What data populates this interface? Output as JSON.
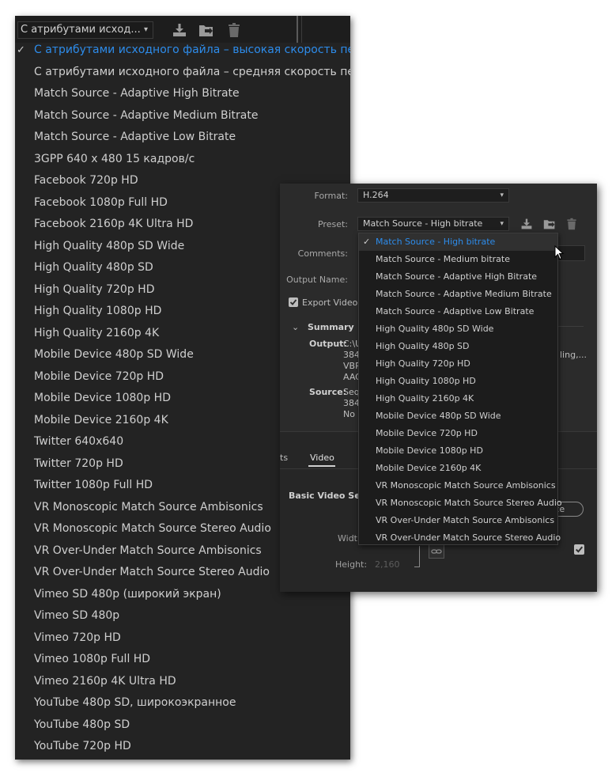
{
  "left": {
    "select_value": "С атрибутами исход...",
    "items": [
      {
        "label": "С атрибутами исходного файла – высокая скорость передачи",
        "selected": true
      },
      {
        "label": "С атрибутами исходного файла – средняя скорость передачи"
      },
      {
        "label": "Match Source - Adaptive High Bitrate"
      },
      {
        "label": "Match Source - Adaptive Medium Bitrate"
      },
      {
        "label": "Match Source - Adaptive Low Bitrate"
      },
      {
        "label": "3GPP 640 x 480 15 кадров/с"
      },
      {
        "label": "Facebook 720p HD"
      },
      {
        "label": "Facebook 1080p Full HD"
      },
      {
        "label": "Facebook 2160p 4K Ultra HD"
      },
      {
        "label": "High Quality 480p SD Wide"
      },
      {
        "label": "High Quality 480p SD"
      },
      {
        "label": "High Quality 720p HD"
      },
      {
        "label": "High Quality 1080p HD"
      },
      {
        "label": "High Quality 2160p 4K"
      },
      {
        "label": "Mobile Device 480p SD Wide"
      },
      {
        "label": "Mobile Device 720p HD"
      },
      {
        "label": "Mobile Device 1080p HD"
      },
      {
        "label": "Mobile Device 2160p 4K"
      },
      {
        "label": "Twitter 640x640"
      },
      {
        "label": "Twitter 720p HD"
      },
      {
        "label": "Twitter 1080p Full HD"
      },
      {
        "label": "VR Monoscopic Match Source Ambisonics"
      },
      {
        "label": "VR Monoscopic Match Source Stereo Audio"
      },
      {
        "label": "VR Over-Under Match Source Ambisonics"
      },
      {
        "label": "VR Over-Under Match Source Stereo Audio"
      },
      {
        "label": "Vimeo SD 480p (широкий экран)"
      },
      {
        "label": "Vimeo SD 480p"
      },
      {
        "label": "Vimeo 720p HD"
      },
      {
        "label": "Vimeo 1080p Full HD"
      },
      {
        "label": "Vimeo 2160p 4K Ultra HD"
      },
      {
        "label": "YouTube 480p SD, широкоэкранное"
      },
      {
        "label": "YouTube 480p SD"
      },
      {
        "label": "YouTube 720p HD"
      }
    ]
  },
  "export": {
    "format_label": "Format:",
    "format_value": "H.264",
    "preset_label": "Preset:",
    "preset_value": "Match Source - High bitrate",
    "comments_label": "Comments:",
    "output_name_label": "Output Name:",
    "export_video_label": "Export Video",
    "summary_label": "Summary",
    "output_label": "Output:",
    "output_lines": [
      "C:\\U",
      "384",
      "VBR",
      "AAC"
    ],
    "output_right": "ling,...",
    "source_label": "Source:",
    "source_lines": [
      "Seq",
      "384",
      "No ."
    ],
    "tab_effects_fragment": "ts",
    "tab_video": "Video",
    "basic_video_label": "Basic Video Setti",
    "width_label": "Widt",
    "height_label": "Height:",
    "height_value": "2,160",
    "match_source_fragment": "rce",
    "dropdown": [
      {
        "label": "Match Source - High bitrate",
        "selected": true
      },
      {
        "label": "Match Source - Medium bitrate"
      },
      {
        "label": "Match Source - Adaptive High Bitrate"
      },
      {
        "label": "Match Source - Adaptive Medium Bitrate"
      },
      {
        "label": "Match Source - Adaptive Low Bitrate"
      },
      {
        "label": "High Quality 480p SD Wide"
      },
      {
        "label": "High Quality 480p SD"
      },
      {
        "label": "High Quality 720p HD"
      },
      {
        "label": "High Quality 1080p HD"
      },
      {
        "label": "High Quality 2160p 4K"
      },
      {
        "label": "Mobile Device 480p SD Wide"
      },
      {
        "label": "Mobile Device 720p HD"
      },
      {
        "label": "Mobile Device 1080p HD"
      },
      {
        "label": "Mobile Device 2160p 4K"
      },
      {
        "label": "VR Monoscopic Match Source Ambisonics"
      },
      {
        "label": "VR Monoscopic Match Source Stereo Audio"
      },
      {
        "label": "VR Over-Under Match Source Ambisonics"
      },
      {
        "label": "VR Over-Under Match Source Stereo Audio"
      }
    ]
  },
  "colors": {
    "accent": "#2d8ceb",
    "panel_bg": "#232323",
    "dialog_bg": "#2b2b2b"
  },
  "icons": [
    "check-icon",
    "chevron-down-icon",
    "import-preset-icon",
    "save-preset-icon",
    "delete-preset-icon",
    "cursor-icon",
    "link-icon",
    "checkbox-icon"
  ]
}
